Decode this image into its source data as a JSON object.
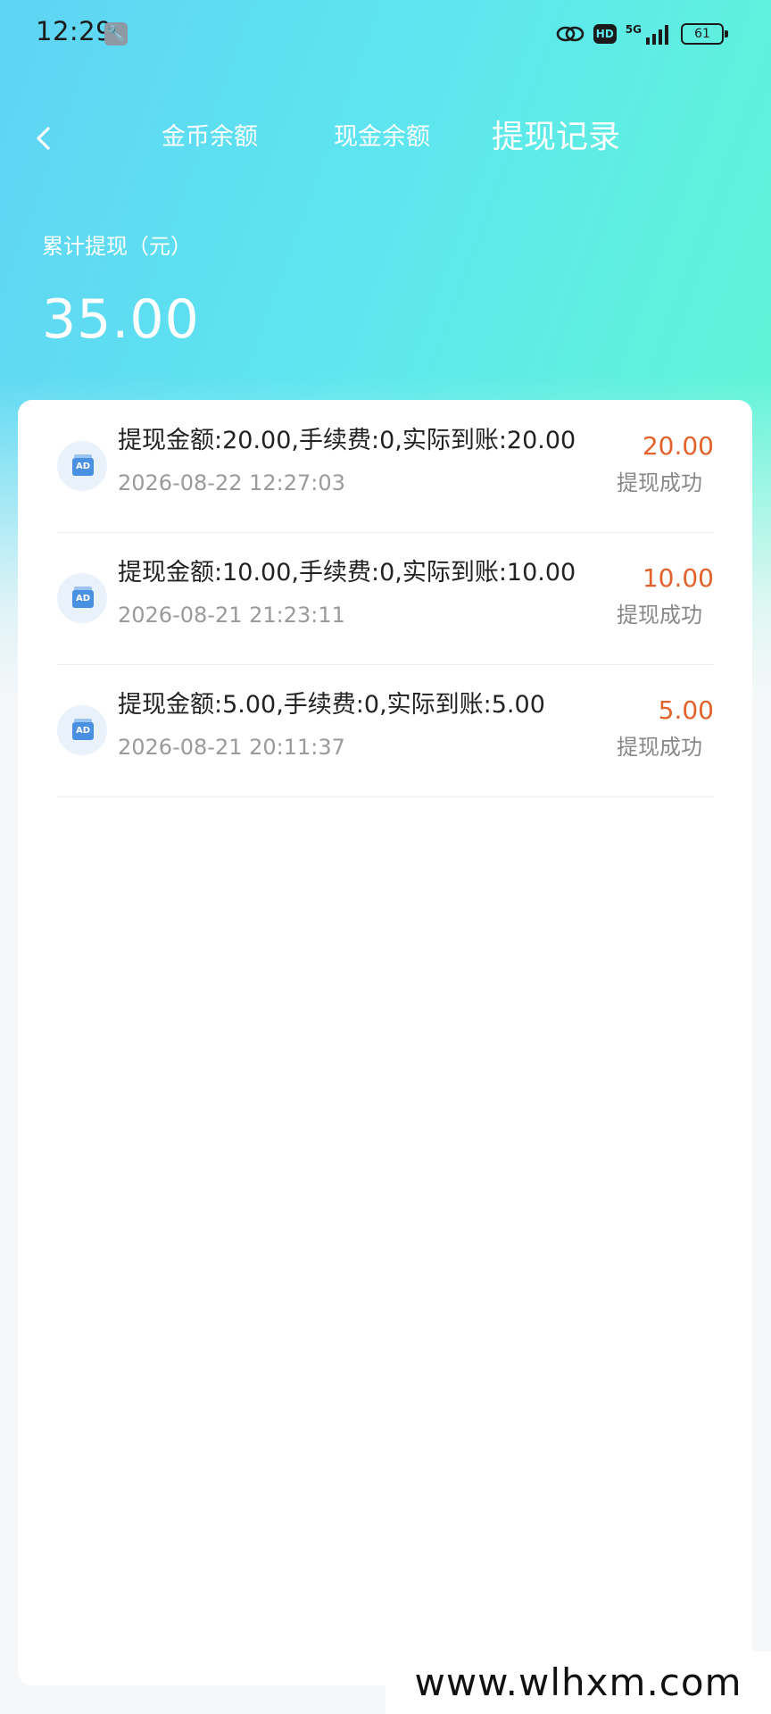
{
  "status_bar": {
    "time": "12:29",
    "network": "5G",
    "hd_label": "HD",
    "battery": "61"
  },
  "nav": {
    "tabs": [
      {
        "label": "金币余额"
      },
      {
        "label": "现金余额"
      },
      {
        "label": "提现记录"
      }
    ],
    "active_tab": "提现记录"
  },
  "summary": {
    "label": "累计提现（元）",
    "amount": "35.00"
  },
  "records": [
    {
      "description": "提现金额:20.00,手续费:0,实际到账:20.00",
      "time": "2026-08-22 12:27:03",
      "amount": "20.00",
      "status": "提现成功",
      "icon_label": "AD"
    },
    {
      "description": "提现金额:10.00,手续费:0,实际到账:10.00",
      "time": "2026-08-21 21:23:11",
      "amount": "10.00",
      "status": "提现成功",
      "icon_label": "AD"
    },
    {
      "description": "提现金额:5.00,手续费:0,实际到账:5.00",
      "time": "2026-08-21 20:11:37",
      "amount": "5.00",
      "status": "提现成功",
      "icon_label": "AD"
    }
  ],
  "watermark": "www.wlhxm.com",
  "colors": {
    "header_gradient_start": "#5fd3f4",
    "header_gradient_end": "#61f6d3",
    "amount_accent": "#e2622c"
  },
  "icons": {
    "back": "chevron-left-icon",
    "wrench": "wrench-icon",
    "record": "ad-icon"
  }
}
